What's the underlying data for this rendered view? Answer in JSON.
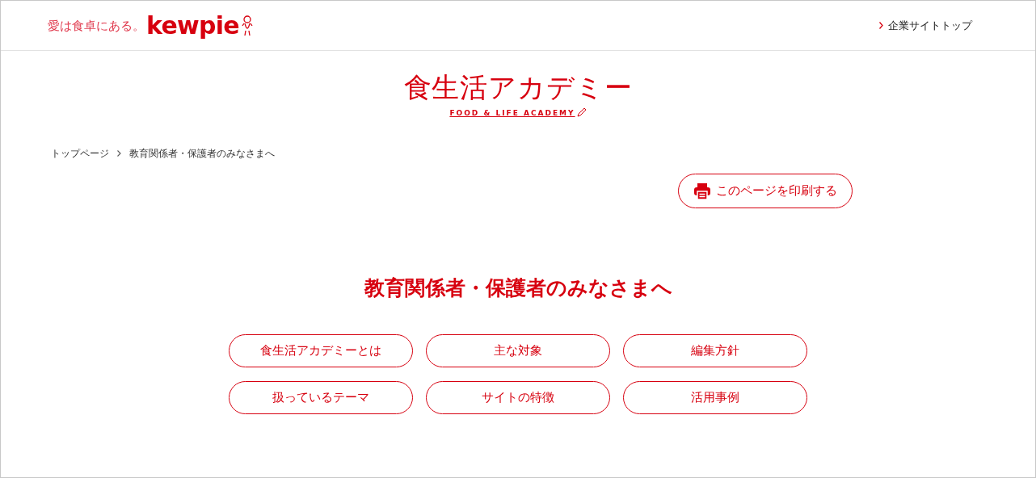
{
  "header": {
    "tagline": "愛は食卓にある。",
    "brand": "kewpie",
    "corporate_link": "企業サイトトップ"
  },
  "site_logo": {
    "title": "食生活アカデミー",
    "subtitle": "FOOD & LIFE ACADEMY"
  },
  "breadcrumb": [
    {
      "label": "トップページ"
    },
    {
      "label": "教育関係者・保護者のみなさまへ"
    }
  ],
  "print_button": "このページを印刷する",
  "heading": "教育関係者・保護者のみなさまへ",
  "nav_buttons": [
    "食生活アカデミーとは",
    "主な対象",
    "編集方針",
    "扱っているテーマ",
    "サイトの特徴",
    "活用事例"
  ]
}
